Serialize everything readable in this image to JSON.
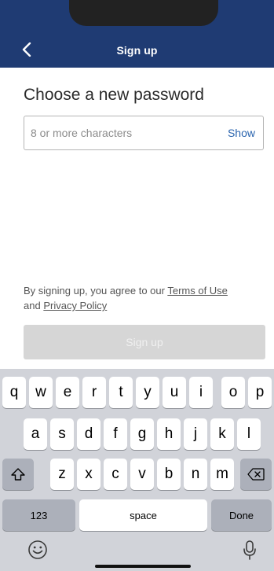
{
  "header": {
    "title": "Sign up",
    "back_icon": "chevron-left-icon",
    "bg_color": "#1f3b73"
  },
  "main": {
    "title": "Choose a new password",
    "password": {
      "placeholder": "8 or more characters",
      "value": "",
      "show_label": "Show"
    },
    "agreement": {
      "prefix": "By signing up, you agree to our",
      "terms_link": "Terms of Use",
      "middle": "and",
      "privacy_link": "Privacy Policy"
    },
    "signup_button": "Sign up"
  },
  "keyboard": {
    "row1": [
      "q",
      "w",
      "e",
      "r",
      "t",
      "y",
      "u",
      "i",
      "o",
      "p"
    ],
    "row2": [
      "a",
      "s",
      "d",
      "f",
      "g",
      "h",
      "j",
      "k",
      "l"
    ],
    "row3": [
      "z",
      "x",
      "c",
      "v",
      "b",
      "n",
      "m"
    ],
    "numbers_key": "123",
    "space_key": "space",
    "done_key": "Done",
    "shift_icon": "shift-icon",
    "backspace_icon": "backspace-icon",
    "emoji_icon": "emoji-icon",
    "mic_icon": "microphone-icon"
  }
}
